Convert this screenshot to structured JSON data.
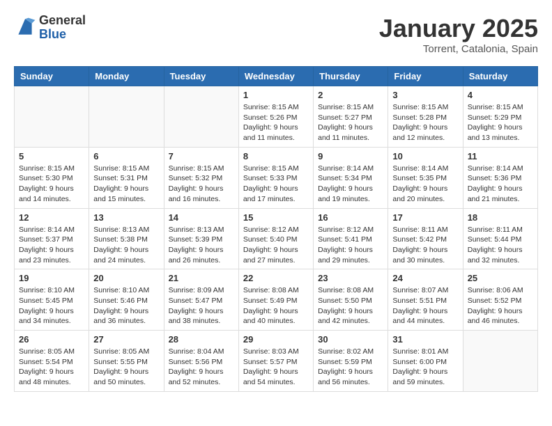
{
  "logo": {
    "general": "General",
    "blue": "Blue"
  },
  "title": "January 2025",
  "location": "Torrent, Catalonia, Spain",
  "headers": [
    "Sunday",
    "Monday",
    "Tuesday",
    "Wednesday",
    "Thursday",
    "Friday",
    "Saturday"
  ],
  "weeks": [
    [
      {
        "day": "",
        "info": ""
      },
      {
        "day": "",
        "info": ""
      },
      {
        "day": "",
        "info": ""
      },
      {
        "day": "1",
        "info": "Sunrise: 8:15 AM\nSunset: 5:26 PM\nDaylight: 9 hours\nand 11 minutes."
      },
      {
        "day": "2",
        "info": "Sunrise: 8:15 AM\nSunset: 5:27 PM\nDaylight: 9 hours\nand 11 minutes."
      },
      {
        "day": "3",
        "info": "Sunrise: 8:15 AM\nSunset: 5:28 PM\nDaylight: 9 hours\nand 12 minutes."
      },
      {
        "day": "4",
        "info": "Sunrise: 8:15 AM\nSunset: 5:29 PM\nDaylight: 9 hours\nand 13 minutes."
      }
    ],
    [
      {
        "day": "5",
        "info": "Sunrise: 8:15 AM\nSunset: 5:30 PM\nDaylight: 9 hours\nand 14 minutes."
      },
      {
        "day": "6",
        "info": "Sunrise: 8:15 AM\nSunset: 5:31 PM\nDaylight: 9 hours\nand 15 minutes."
      },
      {
        "day": "7",
        "info": "Sunrise: 8:15 AM\nSunset: 5:32 PM\nDaylight: 9 hours\nand 16 minutes."
      },
      {
        "day": "8",
        "info": "Sunrise: 8:15 AM\nSunset: 5:33 PM\nDaylight: 9 hours\nand 17 minutes."
      },
      {
        "day": "9",
        "info": "Sunrise: 8:14 AM\nSunset: 5:34 PM\nDaylight: 9 hours\nand 19 minutes."
      },
      {
        "day": "10",
        "info": "Sunrise: 8:14 AM\nSunset: 5:35 PM\nDaylight: 9 hours\nand 20 minutes."
      },
      {
        "day": "11",
        "info": "Sunrise: 8:14 AM\nSunset: 5:36 PM\nDaylight: 9 hours\nand 21 minutes."
      }
    ],
    [
      {
        "day": "12",
        "info": "Sunrise: 8:14 AM\nSunset: 5:37 PM\nDaylight: 9 hours\nand 23 minutes."
      },
      {
        "day": "13",
        "info": "Sunrise: 8:13 AM\nSunset: 5:38 PM\nDaylight: 9 hours\nand 24 minutes."
      },
      {
        "day": "14",
        "info": "Sunrise: 8:13 AM\nSunset: 5:39 PM\nDaylight: 9 hours\nand 26 minutes."
      },
      {
        "day": "15",
        "info": "Sunrise: 8:12 AM\nSunset: 5:40 PM\nDaylight: 9 hours\nand 27 minutes."
      },
      {
        "day": "16",
        "info": "Sunrise: 8:12 AM\nSunset: 5:41 PM\nDaylight: 9 hours\nand 29 minutes."
      },
      {
        "day": "17",
        "info": "Sunrise: 8:11 AM\nSunset: 5:42 PM\nDaylight: 9 hours\nand 30 minutes."
      },
      {
        "day": "18",
        "info": "Sunrise: 8:11 AM\nSunset: 5:44 PM\nDaylight: 9 hours\nand 32 minutes."
      }
    ],
    [
      {
        "day": "19",
        "info": "Sunrise: 8:10 AM\nSunset: 5:45 PM\nDaylight: 9 hours\nand 34 minutes."
      },
      {
        "day": "20",
        "info": "Sunrise: 8:10 AM\nSunset: 5:46 PM\nDaylight: 9 hours\nand 36 minutes."
      },
      {
        "day": "21",
        "info": "Sunrise: 8:09 AM\nSunset: 5:47 PM\nDaylight: 9 hours\nand 38 minutes."
      },
      {
        "day": "22",
        "info": "Sunrise: 8:08 AM\nSunset: 5:49 PM\nDaylight: 9 hours\nand 40 minutes."
      },
      {
        "day": "23",
        "info": "Sunrise: 8:08 AM\nSunset: 5:50 PM\nDaylight: 9 hours\nand 42 minutes."
      },
      {
        "day": "24",
        "info": "Sunrise: 8:07 AM\nSunset: 5:51 PM\nDaylight: 9 hours\nand 44 minutes."
      },
      {
        "day": "25",
        "info": "Sunrise: 8:06 AM\nSunset: 5:52 PM\nDaylight: 9 hours\nand 46 minutes."
      }
    ],
    [
      {
        "day": "26",
        "info": "Sunrise: 8:05 AM\nSunset: 5:54 PM\nDaylight: 9 hours\nand 48 minutes."
      },
      {
        "day": "27",
        "info": "Sunrise: 8:05 AM\nSunset: 5:55 PM\nDaylight: 9 hours\nand 50 minutes."
      },
      {
        "day": "28",
        "info": "Sunrise: 8:04 AM\nSunset: 5:56 PM\nDaylight: 9 hours\nand 52 minutes."
      },
      {
        "day": "29",
        "info": "Sunrise: 8:03 AM\nSunset: 5:57 PM\nDaylight: 9 hours\nand 54 minutes."
      },
      {
        "day": "30",
        "info": "Sunrise: 8:02 AM\nSunset: 5:59 PM\nDaylight: 9 hours\nand 56 minutes."
      },
      {
        "day": "31",
        "info": "Sunrise: 8:01 AM\nSunset: 6:00 PM\nDaylight: 9 hours\nand 59 minutes."
      },
      {
        "day": "",
        "info": ""
      }
    ]
  ]
}
